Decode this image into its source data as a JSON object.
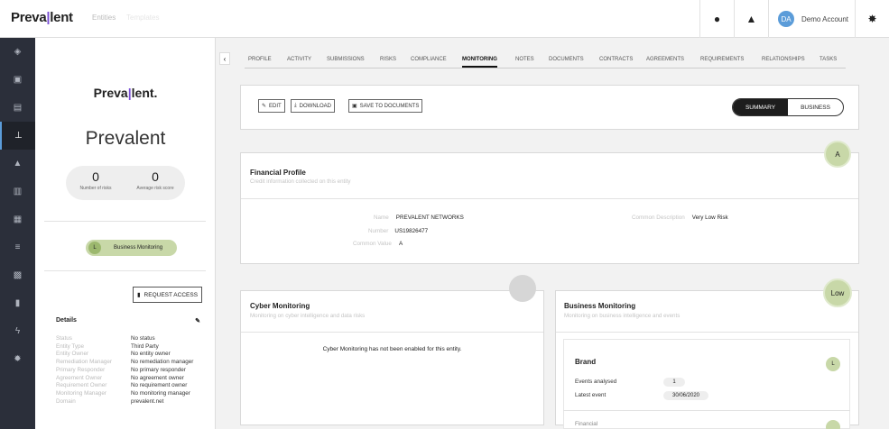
{
  "topbar": {
    "logo_left": "Preva",
    "logo_right": "lent",
    "nav_entities": "Entities",
    "nav_other": "Templates",
    "account_initials": "DA",
    "account_name": "Demo Account"
  },
  "rail": {
    "icons": [
      "dashboard-icon",
      "inbox-icon",
      "document-icon",
      "hierarchy-icon",
      "alert-icon",
      "folder-icon",
      "calendar-icon",
      "list-icon",
      "grid-icon",
      "chart-icon",
      "bolt-icon",
      "gear-icon"
    ],
    "active_index": 3
  },
  "entity": {
    "logo_left": "Preva",
    "logo_right": "lent.",
    "name": "Prevalent",
    "stats": [
      {
        "value": "0",
        "label": "Number of risks"
      },
      {
        "value": "0",
        "label": "Average risk score"
      }
    ],
    "monitoring_badge": "L",
    "monitoring_label": "Business Monitoring",
    "request_access": "REQUEST ACCESS",
    "details_title": "Details",
    "details": [
      {
        "key": "Status",
        "value": "No status"
      },
      {
        "key": "Entity Type",
        "value": "Third Party"
      },
      {
        "key": "Entity Owner",
        "value": "No entity owner"
      },
      {
        "key": "Remediation Manager",
        "value": "No remediation manager"
      },
      {
        "key": "Primary Responder",
        "value": "No primary responder"
      },
      {
        "key": "Agreement Owner",
        "value": "No agreement owner"
      },
      {
        "key": "Requirement Owner",
        "value": "No requirement owner"
      },
      {
        "key": "Monitoring Manager",
        "value": "No monitoring manager"
      },
      {
        "key": "Domain",
        "value": "prevalent.net"
      }
    ]
  },
  "tabs": [
    "PROFILE",
    "ACTIVITY",
    "SUBMISSIONS",
    "RISKS",
    "COMPLIANCE",
    "MONITORING",
    "NOTES",
    "DOCUMENTS",
    "CONTRACTS",
    "AGREEMENTS",
    "REQUIREMENTS",
    "RELATIONSHIPS",
    "TASKS"
  ],
  "active_tab": "MONITORING",
  "actions": {
    "edit": "EDIT",
    "download": "DOWNLOAD",
    "save": "SAVE TO DOCUMENTS",
    "toggle_summary": "SUMMARY",
    "toggle_business": "BUSINESS"
  },
  "financial": {
    "badge": "A",
    "title": "Financial Profile",
    "subtitle": "Credit information collected on this entity",
    "name_key": "Name",
    "name_value": "PREVALENT NETWORKS",
    "number_key": "Number",
    "number_value": "US19826477",
    "common_value_key": "Common Value",
    "common_value": "A",
    "common_desc_key": "Common Description",
    "common_desc_value": "Very Low Risk"
  },
  "cyber": {
    "title": "Cyber Monitoring",
    "subtitle": "Monitoring on cyber intelligence and data risks",
    "message": "Cyber Monitoring has not been enabled for this entity."
  },
  "business": {
    "badge": "Low",
    "title": "Business Monitoring",
    "subtitle": "Monitoring on business intelligence and events",
    "brand_title": "Brand",
    "brand_badge": "L",
    "events_label": "Events analysed",
    "events_value": "1",
    "latest_label": "Latest event",
    "latest_value": "30/06/2020",
    "next_title": "Financial"
  },
  "colors": {
    "accent_green": "#c8d8a8",
    "rail_bg": "#2b2f3a",
    "logo_bar": "#7a4fd6"
  }
}
